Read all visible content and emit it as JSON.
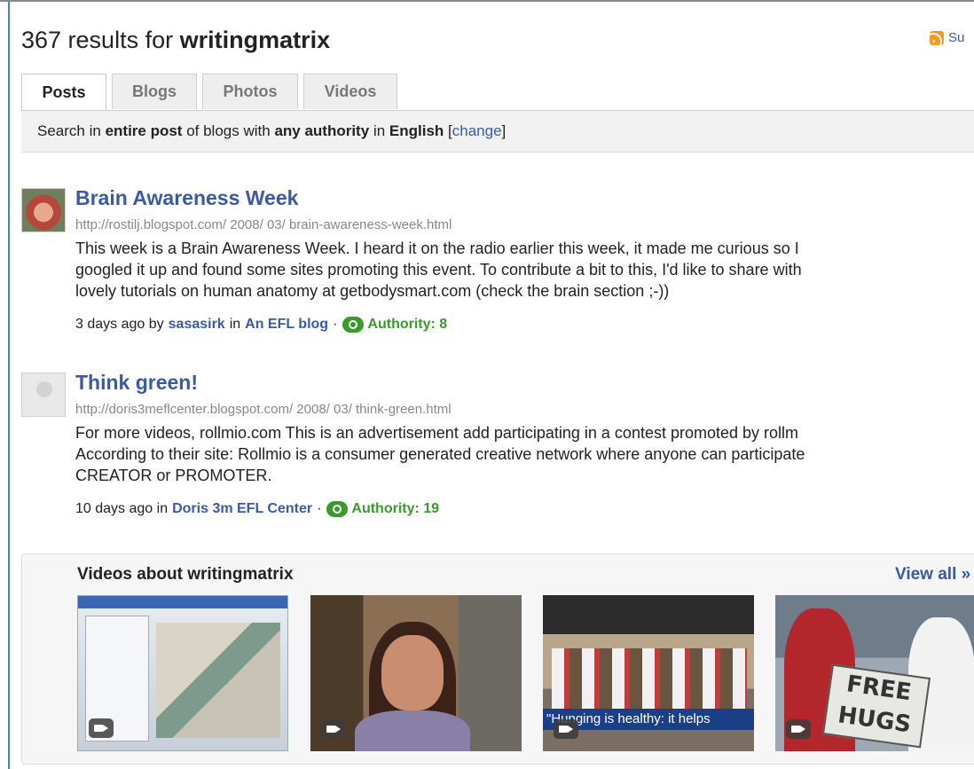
{
  "header": {
    "count": "367 results for",
    "query": "writingmatrix",
    "subscribe_label": "Su"
  },
  "tabs": [
    {
      "label": "Posts",
      "active": true
    },
    {
      "label": "Blogs",
      "active": false
    },
    {
      "label": "Photos",
      "active": false
    },
    {
      "label": "Videos",
      "active": false
    }
  ],
  "searchbar": {
    "prefix": "Search in",
    "scope": "entire post",
    "middle1": "of blogs with",
    "authority": "any authority",
    "middle2": "in",
    "language": "English",
    "bracket_open": "[",
    "change_label": "change",
    "bracket_close": "]"
  },
  "posts": [
    {
      "title": "Brain Awareness Week",
      "url": "http://rostilj.blogspot.com/ 2008/ 03/ brain-awareness-week.html",
      "snippet": [
        "This week is a Brain Awareness Week. I heard it on the radio earlier this week, it made me curious so I",
        "googled it up and found some sites promoting this event. To contribute a bit to this, I'd like to share with",
        "lovely tutorials on human anatomy at getbodysmart.com (check the brain section ;-))"
      ],
      "age": "3 days ago",
      "by_label": "by",
      "author": "sasasirk",
      "in_label": "in",
      "blog": "An EFL blog",
      "sep": "·",
      "authority": "Authority: 8"
    },
    {
      "title": "Think green!",
      "url": "http://doris3meflcenter.blogspot.com/ 2008/ 03/ think-green.html",
      "snippet": [
        "For more videos, rollmio.com This is an advertisement add participating in a contest promoted by rollm",
        "According to their site: Rollmio is a consumer generated creative network where anyone can participate",
        "CREATOR or PROMOTER."
      ],
      "age": "10 days ago",
      "in_label": "in",
      "blog": "Doris 3m EFL Center",
      "sep": "·",
      "authority": "Authority: 19"
    }
  ],
  "videos": {
    "title": "Videos about writingmatrix",
    "view_all": "View all »",
    "thumbs": [
      {
        "icon": "video-camera-icon"
      },
      {
        "icon": "video-camera-icon"
      },
      {
        "icon": "video-camera-icon",
        "caption": "\"Hunging is healthy: it helps"
      },
      {
        "icon": "video-camera-icon",
        "sign": "FREE\nHUGS"
      }
    ]
  },
  "colors": {
    "link": "#3b5aa6",
    "authority": "#3a9a2c",
    "rss": "#f29b24"
  }
}
